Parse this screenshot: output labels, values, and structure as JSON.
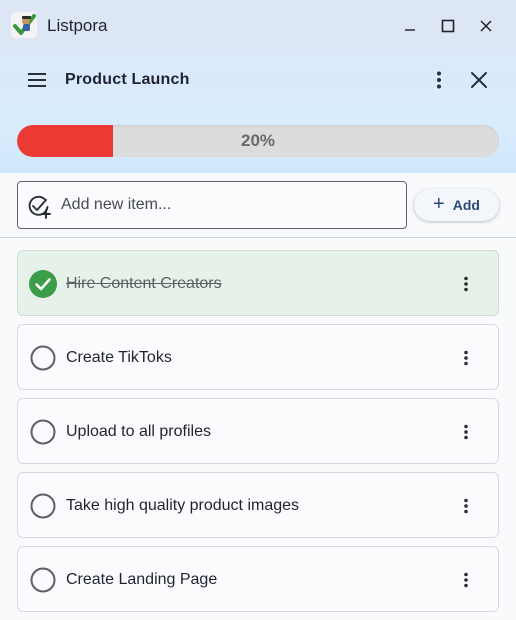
{
  "app": {
    "title": "Listpora"
  },
  "header": {
    "title": "Product Launch"
  },
  "progress": {
    "percent": 20,
    "label": "20%",
    "fill_color": "#ea3a33"
  },
  "add": {
    "placeholder": "Add new item...",
    "button_label": "Add"
  },
  "icons": {
    "menu": "hamburger-icon",
    "more": "kebab-icon",
    "close": "close-icon",
    "add_task": "check-plus-icon",
    "add": "plus-icon"
  },
  "items": [
    {
      "label": "Hire Content Creators",
      "done": true
    },
    {
      "label": "Create TikToks",
      "done": false
    },
    {
      "label": "Upload to all profiles",
      "done": false
    },
    {
      "label": "Take high quality product images",
      "done": false
    },
    {
      "label": "Create Landing Page",
      "done": false
    }
  ]
}
